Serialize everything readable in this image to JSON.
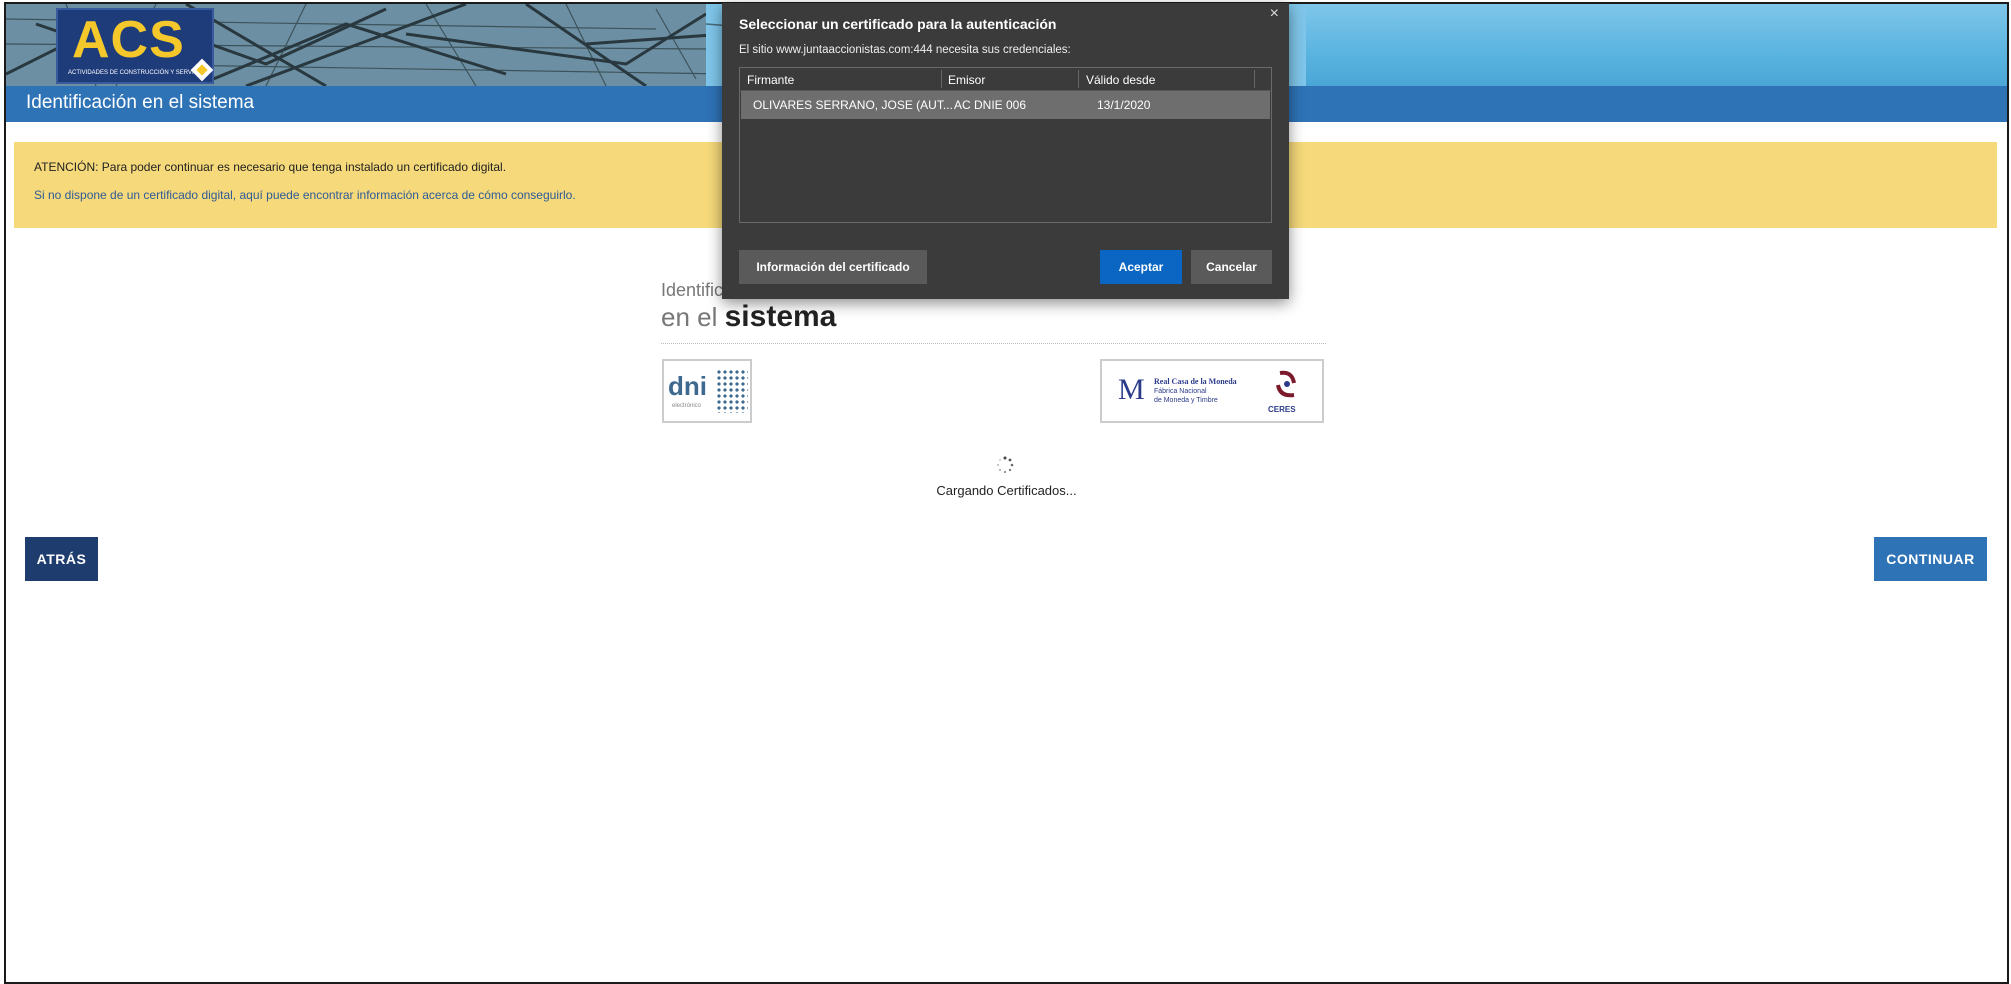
{
  "header": {
    "logo_text": "ACS",
    "logo_subtitle": "ACTIVIDADES DE CONSTRUCCIÓN Y SERVICIOS",
    "page_title": "Identificación en el sistema"
  },
  "notice": {
    "warning": "ATENCIÓN: Para poder continuar es necesario que tenga instalado un certificado digital.",
    "info_link": "Si no dispone de un certificado digital, aquí puede encontrar información acerca de cómo conseguirlo."
  },
  "main": {
    "heading_line1": "Identific",
    "heading_prefix": "en el",
    "heading_bold": "sistema",
    "dni_logo": {
      "text": "dni",
      "subtext": "electrónico"
    },
    "fnmt_logo": {
      "line1": "Real Casa de la Moneda",
      "line2": "Fábrica Nacional",
      "line3": "de Moneda y Timbre",
      "ceres": "CERES"
    },
    "loading_text": "Cargando Certificados..."
  },
  "buttons": {
    "back": "ATRÁS",
    "continue": "CONTINUAR"
  },
  "dialog": {
    "title": "Seleccionar un certificado para la autenticación",
    "subtitle": "El sitio www.juntaaccionistas.com:444 necesita sus credenciales:",
    "columns": [
      "Firmante",
      "Emisor",
      "Válido desde"
    ],
    "rows": [
      {
        "firmante": "OLIVARES SERRANO, JOSE (AUT...",
        "emisor": "AC DNIE 006",
        "valido_desde": "13/1/2020"
      }
    ],
    "info_button": "Información del certificado",
    "accept_button": "Aceptar",
    "cancel_button": "Cancelar",
    "close_glyph": "×"
  },
  "colors": {
    "title_bar": "#2e73b6",
    "notice_bg": "#f5d97a",
    "back_button": "#1f3c6e",
    "continue_button": "#2e73b6",
    "dialog_bg": "#3b3b3b",
    "accept_button": "#0a66c2"
  }
}
